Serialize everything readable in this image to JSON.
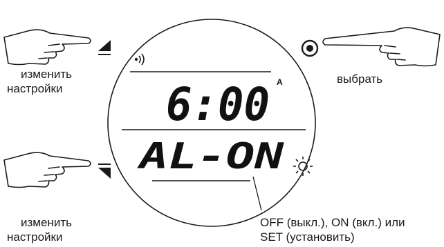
{
  "display": {
    "time": "6:00",
    "ampm": "A",
    "mode": "AL-ON"
  },
  "labels": {
    "left_top_line1": "изменить",
    "left_top_line2": "настройки",
    "left_bottom_line1": "изменить",
    "left_bottom_line2": "настройки",
    "right_top": "выбрать",
    "callout_line1": "OFF (выкл.), ON (вкл.) или",
    "callout_line2": "SET (установить)"
  },
  "icons": [
    "pointing-hand-icon",
    "triangle-up-icon",
    "triangle-down-icon",
    "select-button-icon",
    "sound-icon",
    "sun-icon"
  ],
  "colors": {
    "ink": "#1a1a1a"
  }
}
